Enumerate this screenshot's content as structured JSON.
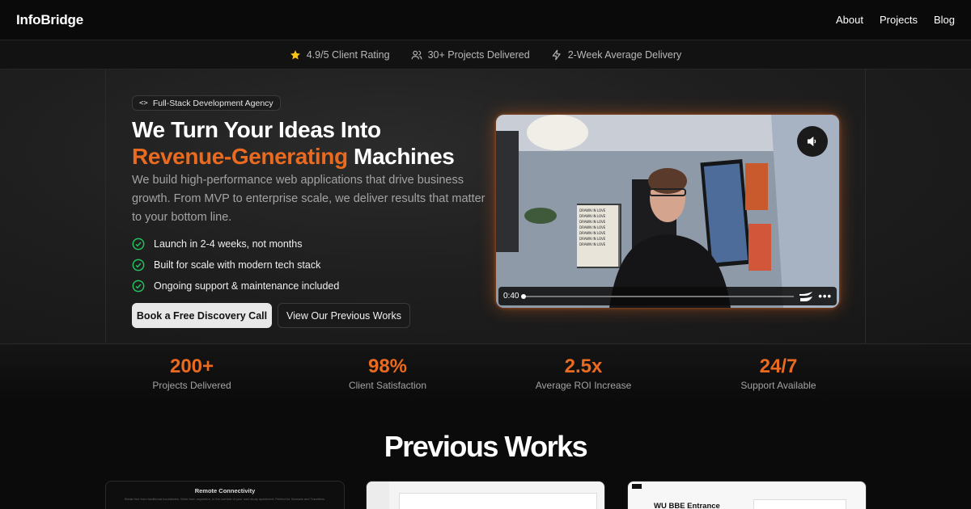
{
  "header": {
    "brand": "InfoBridge",
    "nav": [
      "About",
      "Projects",
      "Blog"
    ]
  },
  "trust": [
    {
      "icon": "star-icon",
      "text": "4.9/5 Client Rating"
    },
    {
      "icon": "users-icon",
      "text": "30+ Projects Delivered"
    },
    {
      "icon": "lightning-icon",
      "text": "2-Week Average Delivery"
    }
  ],
  "hero": {
    "badge": "Full-Stack Development Agency",
    "badge_icon": "code-icon",
    "headline_line1": "We Turn Your Ideas Into",
    "headline_accent": "Revenue-Generating",
    "headline_end": "Machines",
    "description": "We build high-performance web applications that drive business growth. From MVP to enterprise scale, we deliver results that matter to your bottom line.",
    "checks": [
      "Launch in 2-4 weeks, not months",
      "Built for scale with modern tech stack",
      "Ongoing support & maintenance included"
    ],
    "cta_primary": "Book a Free Discovery Call",
    "cta_secondary": "View Our Previous Works",
    "accent_color": "#ea6a1f"
  },
  "video": {
    "time": "0:40",
    "progress": 0.0,
    "mute_icon": "speaker-icon",
    "poster_text": [
      "DRAWN IN LOVE",
      "DRAWN IN LOVE",
      "DRAWN IN LOVE",
      "DRAWN IN LOVE",
      "DRAWN IN LOVE",
      "DRAWN IN LOVE",
      "DRAWN IN LOVE"
    ]
  },
  "stats": [
    {
      "value": "200+",
      "label": "Projects Delivered"
    },
    {
      "value": "98%",
      "label": "Client Satisfaction"
    },
    {
      "value": "2.5x",
      "label": "Average ROI Increase"
    },
    {
      "value": "24/7",
      "label": "Support Available"
    }
  ],
  "works": {
    "title": "Previous Works",
    "cards": [
      {
        "title": "Remote Connectivity",
        "subtitle": "Break free from traditional boundaries. Work from anywhere, in the comfort of your own study apartment. Perfect for Nomads and Travellers."
      },
      {
        "title": ""
      },
      {
        "title": "WU BBE Entrance"
      }
    ]
  }
}
